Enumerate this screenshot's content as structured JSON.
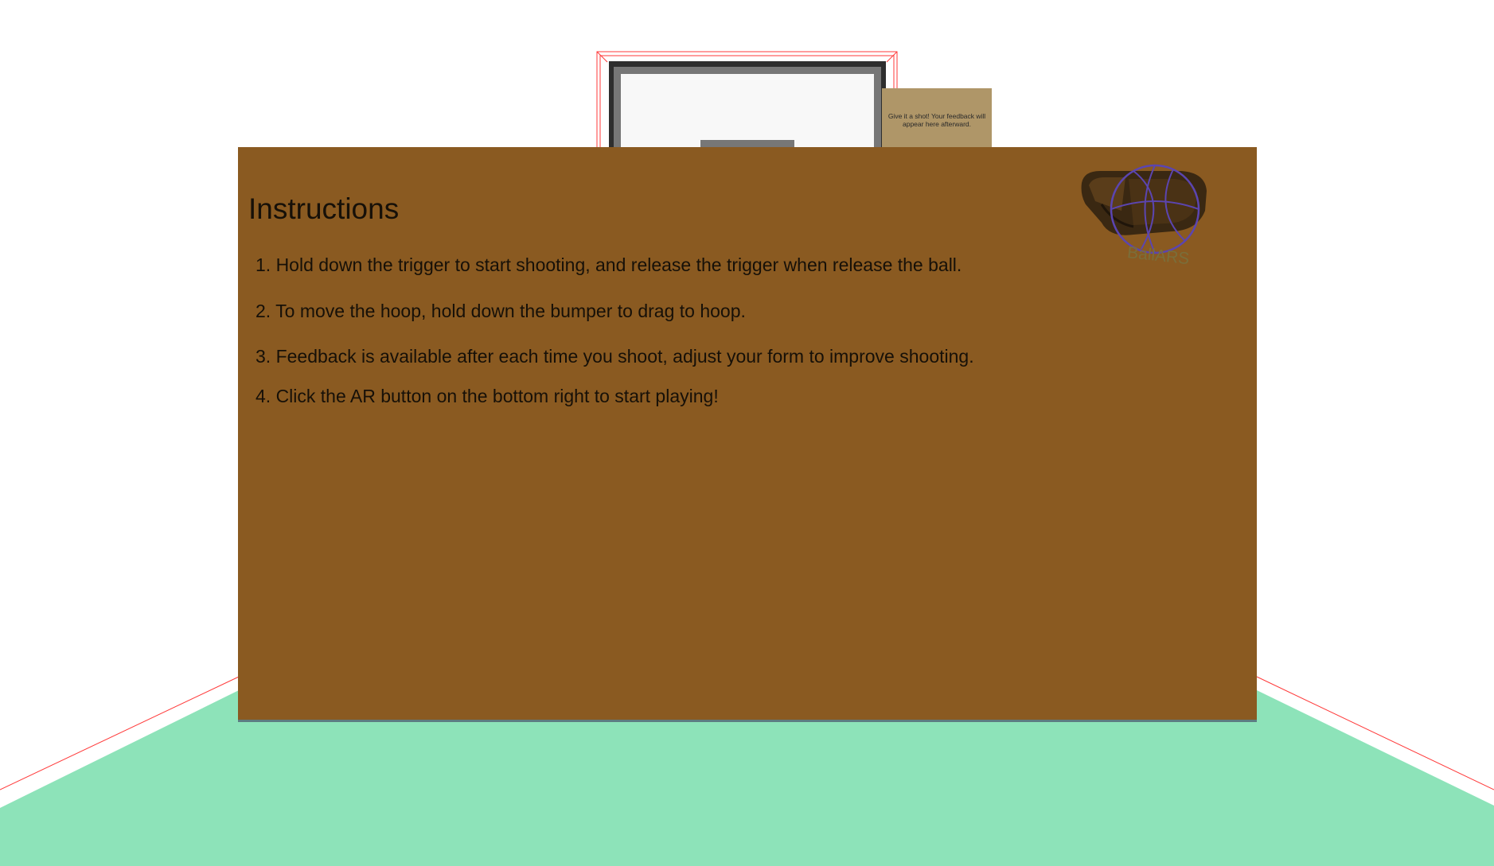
{
  "feedback": {
    "message": "Give it a shot! Your feedback will appear here afterward."
  },
  "instructions": {
    "title": "Instructions",
    "steps": [
      "1. Hold down the trigger to start shooting, and release the trigger when release the ball.",
      "2. To move the hoop, hold down the bumper to drag to hoop.",
      "3. Feedback is available after each time you shoot, adjust your form to improve shooting.",
      "4. Click the AR button on the bottom right to start playing!"
    ]
  },
  "logo": {
    "text": "BallARS",
    "icon": "vr-headset-basketball-icon"
  },
  "colors": {
    "panel": "#8a5a21",
    "floor": "#8de3b9",
    "feedback_panel": "#af9668",
    "boundary_lines": "#ff3a3a",
    "logo_ring": "#5b45b0"
  }
}
